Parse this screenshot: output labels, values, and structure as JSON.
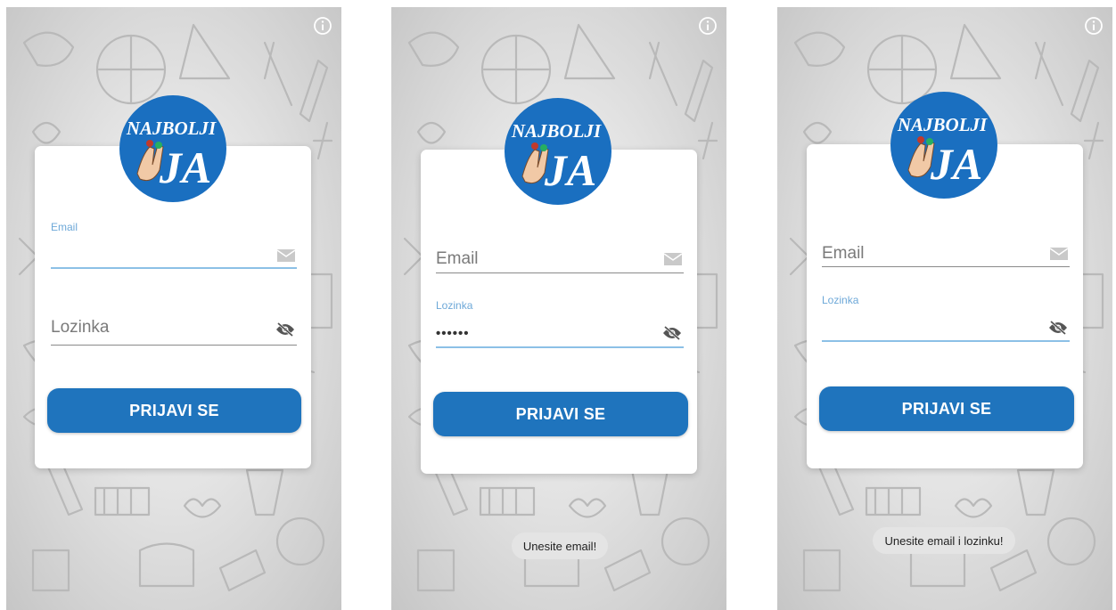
{
  "logo": {
    "line1": "NAJBOLJI",
    "line2": "JA"
  },
  "screens": [
    {
      "email": {
        "label": "Email",
        "value": ""
      },
      "password": {
        "placeholder": "Lozinka",
        "value": ""
      },
      "login_button": "PRIJAVI SE",
      "toast": ""
    },
    {
      "email": {
        "placeholder": "Email",
        "value": ""
      },
      "password": {
        "label": "Lozinka",
        "value": "••••••"
      },
      "login_button": "PRIJAVI SE",
      "toast": "Unesite email!"
    },
    {
      "email": {
        "placeholder": "Email",
        "value": ""
      },
      "password": {
        "label": "Lozinka",
        "value": ""
      },
      "login_button": "PRIJAVI SE",
      "toast": "Unesite email i lozinku!"
    }
  ],
  "icons": {
    "info": "info-icon",
    "email": "envelope-icon",
    "password": "eye-off-icon"
  },
  "colors": {
    "accent": "#1f74bd",
    "focus_line": "#8cc0e6",
    "logo_bg": "#1a6fc0"
  }
}
